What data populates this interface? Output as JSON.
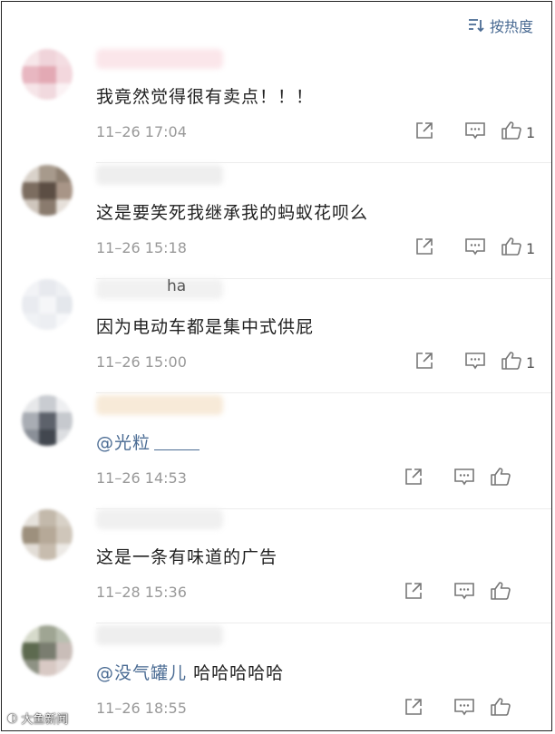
{
  "header": {
    "sort_label": "按热度"
  },
  "comments": [
    {
      "text": "我竟然觉得很有卖点！！！",
      "time": "11–26 17:04",
      "likes": "1",
      "avatar_colors": [
        "#f7e7ea",
        "#f0d4da",
        "#f4dde2",
        "#e8b7c1",
        "#e3a9b4",
        "#f3d7dd",
        "#f6e5e8",
        "#f1d9de",
        "#fbf2f4"
      ],
      "name_color": "#fbe6ea"
    },
    {
      "text": "这是要笑死我继承我的蚂蚁花呗么",
      "time": "11–26 15:18",
      "likes": "1",
      "avatar_colors": [
        "#d9d2ca",
        "#a79a8c",
        "#8f8071",
        "#7c6d60",
        "#5c4e44",
        "#a89587",
        "#cfc6bd",
        "#8a7b6e",
        "#e6e0da"
      ],
      "name_color": "#eeeeee"
    },
    {
      "text": "因为电动车都是集中式供屁",
      "time": "11–26 15:00",
      "likes": "1",
      "name_suffix": "ha",
      "avatar_colors": [
        "#f2f3f6",
        "#e7e9ee",
        "#eef0f3",
        "#e9ebf0",
        "#f5f6f8",
        "#e4e7ec",
        "#f0f2f5",
        "#eceef2",
        "#f7f8fa"
      ],
      "name_color": "#f1f1f1"
    },
    {
      "text": "",
      "mention": "@光粒",
      "time": "11–26 14:53",
      "likes": "",
      "avatar_colors": [
        "#e7e8ea",
        "#c9ccd1",
        "#eeeff1",
        "#a9adb4",
        "#5d626b",
        "#c6c9ce",
        "#8b9098",
        "#42474f",
        "#dcdee1"
      ],
      "name_color": "#f7ead8"
    },
    {
      "text": "这是一条有味道的广告",
      "time": "11–28 15:36",
      "likes": "",
      "avatar_colors": [
        "#e6e2dc",
        "#c3b9ab",
        "#d8d1c7",
        "#9d907d",
        "#b6a998",
        "#cfc6ba",
        "#e2ddd6",
        "#c7bcae",
        "#ece9e5"
      ],
      "name_color": "#f0f0f0"
    },
    {
      "text": "哈哈哈哈哈",
      "mention": "@没气罐儿",
      "time": "11–26 18:55",
      "likes": "",
      "avatar_colors": [
        "#d6dacb",
        "#9fa593",
        "#b9bfb0",
        "#5d6a4f",
        "#7a7d70",
        "#c9bdb8",
        "#8e9284",
        "#d8c9c4",
        "#e2d8d5"
      ],
      "name_color": "#eeeeee"
    }
  ],
  "watermark": "大鱼新闻"
}
